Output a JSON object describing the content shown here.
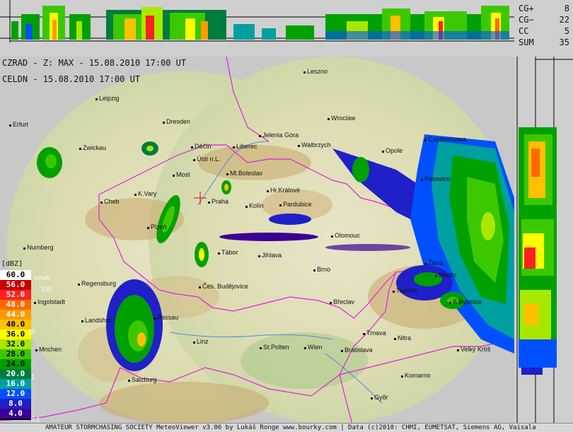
{
  "stats": [
    {
      "key": "CG+",
      "value": "8"
    },
    {
      "key": "CG−",
      "value": "22"
    },
    {
      "key": "CC",
      "value": "5"
    },
    {
      "key": "SUM",
      "value": "35"
    }
  ],
  "info": {
    "line1": "CZRAD - Z: MAX - 15.08.2010 17:00 UT",
    "line2": "CELDN - 15.08.2010 17:00 UT"
  },
  "legend": {
    "unit_dbz": "[dBZ]",
    "unit_mmh": "mm/h",
    "levels": [
      {
        "label": "60.0",
        "color": "#ffffff",
        "text": "#000000"
      },
      {
        "label": "56.0",
        "color": "#c80000",
        "text": "#ffffff"
      },
      {
        "label": "52.0",
        "color": "#ff2020",
        "text": "#ffffff"
      },
      {
        "label": "48.0",
        "color": "#ff6a00",
        "text": "#ffffff"
      },
      {
        "label": "44.0",
        "color": "#ff9a00",
        "text": "#ffffff"
      },
      {
        "label": "40.0",
        "color": "#ffc000",
        "text": "#000000"
      },
      {
        "label": "36.0",
        "color": "#ffff00",
        "text": "#000000"
      },
      {
        "label": "32.0",
        "color": "#a8e800",
        "text": "#000000"
      },
      {
        "label": "28.0",
        "color": "#3cc800",
        "text": "#000000"
      },
      {
        "label": "24.0",
        "color": "#00a000",
        "text": "#000000"
      },
      {
        "label": "20.0",
        "color": "#007c3c",
        "text": "#ffffff"
      },
      {
        "label": "16.0",
        "color": "#00a0a0",
        "text": "#ffffff"
      },
      {
        "label": "12.0",
        "color": "#0050ff",
        "text": "#ffffff"
      },
      {
        "label": "8.0",
        "color": "#2020c8",
        "text": "#ffffff"
      },
      {
        "label": "4.0",
        "color": "#3c0096",
        "text": "#ffffff"
      }
    ],
    "mm_values": [
      "100",
      "10",
      "1",
      "0.1"
    ]
  },
  "cities": [
    {
      "name": "Leszno"
    },
    {
      "name": "Leipzig"
    },
    {
      "name": "Dresden"
    },
    {
      "name": "Wroclaw"
    },
    {
      "name": "Erfurt"
    },
    {
      "name": "Jelenia Gora"
    },
    {
      "name": "Opole"
    },
    {
      "name": "Czestochowa"
    },
    {
      "name": "Zwickau"
    },
    {
      "name": "Děčín"
    },
    {
      "name": "Liberec"
    },
    {
      "name": "Walbrzych"
    },
    {
      "name": "Ústí n.L."
    },
    {
      "name": "Ml.Boleslav"
    },
    {
      "name": "Most"
    },
    {
      "name": "Hr.Králové"
    },
    {
      "name": "K.Vary"
    },
    {
      "name": "Praha"
    },
    {
      "name": "Kolín"
    },
    {
      "name": "Pardubice"
    },
    {
      "name": "Cheb"
    },
    {
      "name": "Plzeň"
    },
    {
      "name": "Olomouc"
    },
    {
      "name": "Tábor"
    },
    {
      "name": "Jihlava"
    },
    {
      "name": "Nurnberg"
    },
    {
      "name": "Brno"
    },
    {
      "name": "Žilina"
    },
    {
      "name": "Regensburg"
    },
    {
      "name": "Čes. Budějovice"
    },
    {
      "name": "Ingolstadt"
    },
    {
      "name": "Trenčín"
    },
    {
      "name": "B.Bystrica"
    },
    {
      "name": "Břeclav"
    },
    {
      "name": "Landshut"
    },
    {
      "name": "Passau"
    },
    {
      "name": "Trnava"
    },
    {
      "name": "Nitra"
    },
    {
      "name": "Linz"
    },
    {
      "name": "St.Polten"
    },
    {
      "name": "Wien"
    },
    {
      "name": "Bratislava"
    },
    {
      "name": "Velký Krtíš"
    },
    {
      "name": "Salzburg"
    },
    {
      "name": "Komarno"
    },
    {
      "name": "Győr"
    },
    {
      "name": "Katowice"
    },
    {
      "name": "Martin"
    },
    {
      "name": "Mnchen"
    }
  ],
  "footer": "AMATEUR STORMCHASING SOCIETY MeteoViewer v3.06 by Lukáš Ronge www.bourky.com | Data (c)2010: CHMI, EUMETSAT, Siemens AG, Vaisala"
}
